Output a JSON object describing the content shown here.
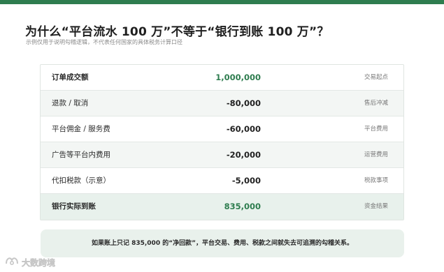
{
  "page": {
    "title": "为什么“平台流水 100 万”不等于“银行到账 100 万”？",
    "subtitle": "示例仅用于说明勾稽逻辑，不代表任何国家的具体税务计算口径"
  },
  "table": {
    "rows": [
      {
        "label": "订单成交额",
        "value": "1,000,000",
        "tag": "交易起点"
      },
      {
        "label": "退款 / 取消",
        "value": "-80,000",
        "tag": "售后冲减"
      },
      {
        "label": "平台佣金 / 服务费",
        "value": "-60,000",
        "tag": "平台费用"
      },
      {
        "label": "广告等平台内费用",
        "value": "-20,000",
        "tag": "运营费用"
      },
      {
        "label": "代扣税款（示意）",
        "value": "-5,000",
        "tag": "税款事项"
      },
      {
        "label": "银行实际到账",
        "value": "835,000",
        "tag": "资金结果"
      }
    ]
  },
  "note": "如果账上只记 835,000 的“净回款”，平台交易、费用、税款之间就失去可追溯的勾稽关系。",
  "watermark": {
    "text": "大数跨境",
    "icon": "brand-logo-icon"
  },
  "colors": {
    "accent": "#2e7d4f",
    "highlight_row": "#e8f1ec",
    "alt_row": "#f3f6f4",
    "note_bg": "#e9f1ec"
  }
}
